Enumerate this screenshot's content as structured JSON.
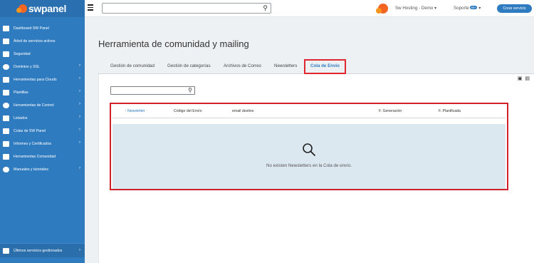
{
  "brand": {
    "logo_text": "swpanel"
  },
  "topbar": {
    "search_placeholder": "",
    "user_label": "Sw Hosting - Demo",
    "user_chevron": "▾",
    "support_label": "Soporte",
    "support_badge": "99+",
    "support_chevron": "▾",
    "create_button": "Crear servicio"
  },
  "sidebar": {
    "items": [
      {
        "label": "Dashboard SW Panel",
        "chevron": ""
      },
      {
        "label": "Árbol de servicios activos",
        "chevron": ""
      },
      {
        "label": "Seguridad",
        "chevron": ""
      },
      {
        "label": "Dominios y SSL",
        "chevron": "›"
      },
      {
        "label": "Herramientas para Clouds",
        "chevron": "›"
      },
      {
        "label": "Plantillas",
        "chevron": "›"
      },
      {
        "label": "Herramientas de Control",
        "chevron": "›"
      },
      {
        "label": "Listados",
        "chevron": "›"
      },
      {
        "label": "Colas de SW Panel",
        "chevron": "›"
      },
      {
        "label": "Informes y Certificados",
        "chevron": "›"
      },
      {
        "label": "Herramientas Comunidad",
        "chevron": ""
      },
      {
        "label": "Manuales y tutoriales",
        "chevron": "›"
      }
    ],
    "bottom": {
      "label": "Últimos servicios gestionados",
      "chevron": "›"
    }
  },
  "main": {
    "title": "Herramienta de comunidad y mailing",
    "tabs": [
      {
        "label": "Gestión de comunidad"
      },
      {
        "label": "Gestión de categorías"
      },
      {
        "label": "Archivos de Correo"
      },
      {
        "label": "Newsletters"
      },
      {
        "label": "Cola de Envío"
      }
    ],
    "active_tab": "Cola de Envío",
    "panel_icons": "▣ ▤",
    "search_value": "",
    "table": {
      "columns": [
        {
          "label": "↑ Newsletter"
        },
        {
          "label": "Código del Envío"
        },
        {
          "label": "email destino"
        },
        {
          "label": "F. Generación"
        },
        {
          "label": "F. Planificada"
        }
      ],
      "empty_message": "No existen Newsletters en la Cola de envío."
    }
  },
  "colors": {
    "sidebar": "#2f7bc0",
    "accent": "#2f7bc0",
    "highlight": "#e0262f",
    "brand_orange": "#f26522"
  }
}
